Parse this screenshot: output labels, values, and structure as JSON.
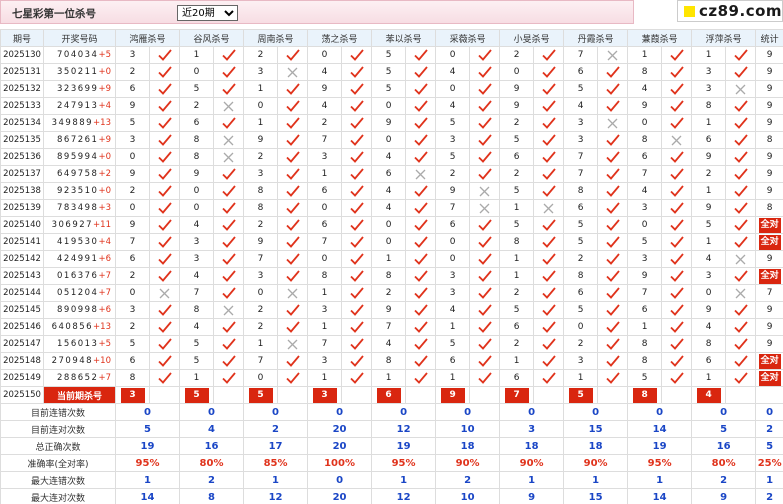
{
  "header": {
    "title": "七星彩第一位杀号",
    "period_select": "近20期",
    "period_options": [
      "近20期"
    ],
    "logo_text": "cz89.com"
  },
  "columns": [
    "期号",
    "开奖号码",
    "鸿雁杀号",
    "谷风杀号",
    "周南杀号",
    "荡之杀号",
    "苯以杀号",
    "采薇杀号",
    "小旻杀号",
    "丹霞杀号",
    "蒹葭杀号",
    "浮萍杀号",
    "统计"
  ],
  "rows": [
    {
      "issue": "2025130",
      "draw": "704034",
      "sum": "+5",
      "kills": [
        3,
        1,
        2,
        0,
        5,
        0,
        2,
        7,
        1,
        1
      ],
      "hits": [
        1,
        1,
        1,
        1,
        1,
        1,
        1,
        0,
        1,
        1
      ],
      "stat": "9"
    },
    {
      "issue": "2025131",
      "draw": "350211",
      "sum": "+0",
      "kills": [
        2,
        0,
        3,
        4,
        5,
        4,
        0,
        6,
        8,
        3
      ],
      "hits": [
        1,
        1,
        0,
        1,
        1,
        1,
        1,
        1,
        1,
        1
      ],
      "stat": "9"
    },
    {
      "issue": "2025132",
      "draw": "323699",
      "sum": "+9",
      "kills": [
        6,
        5,
        1,
        9,
        5,
        0,
        9,
        5,
        4,
        3
      ],
      "hits": [
        1,
        1,
        1,
        1,
        1,
        1,
        1,
        1,
        1,
        0
      ],
      "stat": "9"
    },
    {
      "issue": "2025133",
      "draw": "247913",
      "sum": "+4",
      "kills": [
        9,
        2,
        0,
        4,
        0,
        4,
        9,
        4,
        9,
        8
      ],
      "hits": [
        1,
        0,
        1,
        1,
        1,
        1,
        1,
        1,
        1,
        1
      ],
      "stat": "9"
    },
    {
      "issue": "2025134",
      "draw": "349889",
      "sum": "+13",
      "kills": [
        5,
        6,
        1,
        2,
        9,
        5,
        2,
        3,
        0,
        1
      ],
      "hits": [
        1,
        1,
        1,
        1,
        1,
        1,
        1,
        0,
        1,
        1
      ],
      "stat": "9"
    },
    {
      "issue": "2025135",
      "draw": "867261",
      "sum": "+9",
      "kills": [
        3,
        8,
        9,
        7,
        0,
        3,
        5,
        3,
        8,
        6
      ],
      "hits": [
        1,
        0,
        1,
        1,
        1,
        1,
        1,
        1,
        0,
        1
      ],
      "stat": "8"
    },
    {
      "issue": "2025136",
      "draw": "895994",
      "sum": "+0",
      "kills": [
        0,
        8,
        2,
        3,
        4,
        5,
        6,
        7,
        6,
        9
      ],
      "hits": [
        1,
        0,
        1,
        1,
        1,
        1,
        1,
        1,
        1,
        1
      ],
      "stat": "9"
    },
    {
      "issue": "2025137",
      "draw": "649758",
      "sum": "+2",
      "kills": [
        9,
        9,
        3,
        1,
        6,
        2,
        2,
        7,
        7,
        2
      ],
      "hits": [
        1,
        1,
        1,
        1,
        0,
        1,
        1,
        1,
        1,
        1
      ],
      "stat": "9"
    },
    {
      "issue": "2025138",
      "draw": "923510",
      "sum": "+0",
      "kills": [
        2,
        0,
        8,
        6,
        4,
        9,
        5,
        8,
        4,
        1
      ],
      "hits": [
        1,
        1,
        1,
        1,
        1,
        0,
        1,
        1,
        1,
        1
      ],
      "stat": "9"
    },
    {
      "issue": "2025139",
      "draw": "783498",
      "sum": "+3",
      "kills": [
        0,
        0,
        8,
        0,
        4,
        7,
        1,
        6,
        3,
        9
      ],
      "hits": [
        1,
        1,
        1,
        1,
        1,
        0,
        0,
        1,
        1,
        1
      ],
      "stat": "8"
    },
    {
      "issue": "2025140",
      "draw": "306927",
      "sum": "+11",
      "kills": [
        9,
        4,
        2,
        6,
        0,
        6,
        5,
        5,
        0,
        5
      ],
      "hits": [
        1,
        1,
        1,
        1,
        1,
        1,
        1,
        1,
        1,
        1
      ],
      "stat": "全对"
    },
    {
      "issue": "2025141",
      "draw": "419530",
      "sum": "+4",
      "kills": [
        7,
        3,
        9,
        7,
        0,
        0,
        8,
        5,
        5,
        1
      ],
      "hits": [
        1,
        1,
        1,
        1,
        1,
        1,
        1,
        1,
        1,
        1
      ],
      "stat": "全对"
    },
    {
      "issue": "2025142",
      "draw": "424991",
      "sum": "+6",
      "kills": [
        6,
        3,
        7,
        0,
        1,
        0,
        1,
        2,
        3,
        4
      ],
      "hits": [
        1,
        1,
        1,
        1,
        1,
        1,
        1,
        1,
        1,
        0
      ],
      "stat": "9"
    },
    {
      "issue": "2025143",
      "draw": "016376",
      "sum": "+7",
      "kills": [
        2,
        4,
        3,
        8,
        8,
        3,
        1,
        8,
        9,
        3
      ],
      "hits": [
        1,
        1,
        1,
        1,
        1,
        1,
        1,
        1,
        1,
        1
      ],
      "stat": "全对"
    },
    {
      "issue": "2025144",
      "draw": "051204",
      "sum": "+7",
      "kills": [
        0,
        7,
        0,
        1,
        2,
        3,
        2,
        6,
        7,
        0
      ],
      "hits": [
        0,
        1,
        0,
        1,
        1,
        1,
        1,
        1,
        1,
        0
      ],
      "stat": "7"
    },
    {
      "issue": "2025145",
      "draw": "890998",
      "sum": "+6",
      "kills": [
        3,
        8,
        2,
        3,
        9,
        4,
        5,
        5,
        6,
        9
      ],
      "hits": [
        1,
        0,
        1,
        1,
        1,
        1,
        1,
        1,
        1,
        1
      ],
      "stat": "9"
    },
    {
      "issue": "2025146",
      "draw": "640856",
      "sum": "+13",
      "kills": [
        2,
        4,
        2,
        1,
        7,
        1,
        6,
        0,
        1,
        4
      ],
      "hits": [
        1,
        1,
        1,
        1,
        1,
        1,
        1,
        1,
        1,
        1
      ],
      "stat": "9"
    },
    {
      "issue": "2025147",
      "draw": "156013",
      "sum": "+5",
      "kills": [
        5,
        5,
        1,
        7,
        4,
        5,
        2,
        2,
        8,
        8
      ],
      "hits": [
        1,
        1,
        0,
        1,
        1,
        1,
        1,
        1,
        1,
        1
      ],
      "stat": "9"
    },
    {
      "issue": "2025148",
      "draw": "270948",
      "sum": "+10",
      "kills": [
        6,
        5,
        7,
        3,
        8,
        6,
        1,
        3,
        8,
        6
      ],
      "hits": [
        1,
        1,
        1,
        1,
        1,
        1,
        1,
        1,
        1,
        1
      ],
      "stat": "全对"
    },
    {
      "issue": "2025149",
      "draw": "288652",
      "sum": "+7",
      "kills": [
        8,
        1,
        0,
        1,
        1,
        1,
        6,
        1,
        5,
        1
      ],
      "hits": [
        1,
        1,
        1,
        1,
        1,
        1,
        1,
        1,
        1,
        1
      ],
      "stat": "全对"
    }
  ],
  "current": {
    "issue": "2025150",
    "label": "当前期杀号",
    "kills": [
      "3",
      "5",
      "5",
      "3",
      "6",
      "9",
      "7",
      "5",
      "8",
      "4"
    ]
  },
  "summary": [
    {
      "label": "目前连错次数",
      "values": [
        "0",
        "0",
        "0",
        "0",
        "0",
        "0",
        "0",
        "0",
        "0",
        "0",
        "0"
      ],
      "red": false
    },
    {
      "label": "目前连对次数",
      "values": [
        "5",
        "4",
        "2",
        "20",
        "12",
        "10",
        "3",
        "15",
        "14",
        "5",
        "2"
      ],
      "red": false
    },
    {
      "label": "总正确次数",
      "values": [
        "19",
        "16",
        "17",
        "20",
        "19",
        "18",
        "18",
        "18",
        "19",
        "16",
        "5"
      ],
      "red": false
    },
    {
      "label": "准确率(全对率)",
      "values": [
        "95%",
        "80%",
        "85%",
        "100%",
        "95%",
        "90%",
        "90%",
        "90%",
        "95%",
        "80%",
        "25%"
      ],
      "red": true
    },
    {
      "label": "最大连错次数",
      "values": [
        "1",
        "2",
        "1",
        "0",
        "1",
        "2",
        "1",
        "1",
        "1",
        "2",
        "1"
      ],
      "red": false
    },
    {
      "label": "最大连对次数",
      "values": [
        "14",
        "8",
        "12",
        "20",
        "12",
        "10",
        "9",
        "15",
        "14",
        "9",
        "2"
      ],
      "red": false
    }
  ],
  "icons": {
    "hit": "check-icon",
    "miss": "cross-icon"
  },
  "colors": {
    "accent": "#d9260f",
    "blue": "#1a46c6",
    "check": "#e0331c",
    "cross": "#aaaaaa",
    "header_bg": "#eaf3fb"
  }
}
